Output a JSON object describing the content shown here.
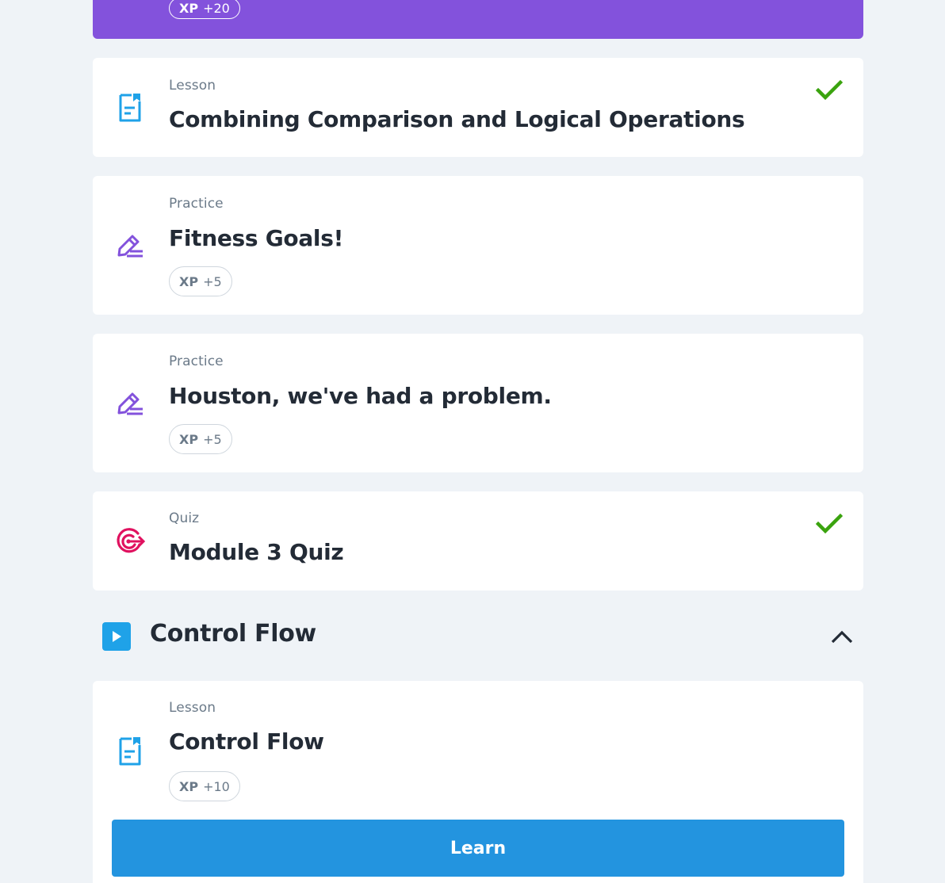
{
  "top_card": {
    "xp_label": "XP",
    "xp_value": "+20"
  },
  "items": [
    {
      "type": "Lesson",
      "title": "Combining Comparison and Logical Operations",
      "icon": "lesson-doc-icon",
      "completed": true
    },
    {
      "type": "Practice",
      "title": "Fitness Goals!",
      "icon": "practice-pencil-icon",
      "xp_label": "XP",
      "xp_value": "+5"
    },
    {
      "type": "Practice",
      "title": "Houston, we've had a problem.",
      "icon": "practice-pencil-icon",
      "xp_label": "XP",
      "xp_value": "+5"
    },
    {
      "type": "Quiz",
      "title": "Module 3 Quiz",
      "icon": "quiz-target-icon",
      "completed": true
    }
  ],
  "section": {
    "title": "Control Flow",
    "icon": "play-icon",
    "expanded": true
  },
  "section_items": [
    {
      "type": "Lesson",
      "title": "Control Flow",
      "icon": "lesson-doc-icon",
      "xp_label": "XP",
      "xp_value": "+10",
      "button_label": "Learn"
    }
  ],
  "colors": {
    "background": "#eff3f7",
    "card": "#ffffff",
    "accent_purple": "#8352dc",
    "lesson_blue": "#1fa2e8",
    "quiz_pink": "#e0115f",
    "check_green": "#3aa30e",
    "learn_button": "#2394df"
  }
}
